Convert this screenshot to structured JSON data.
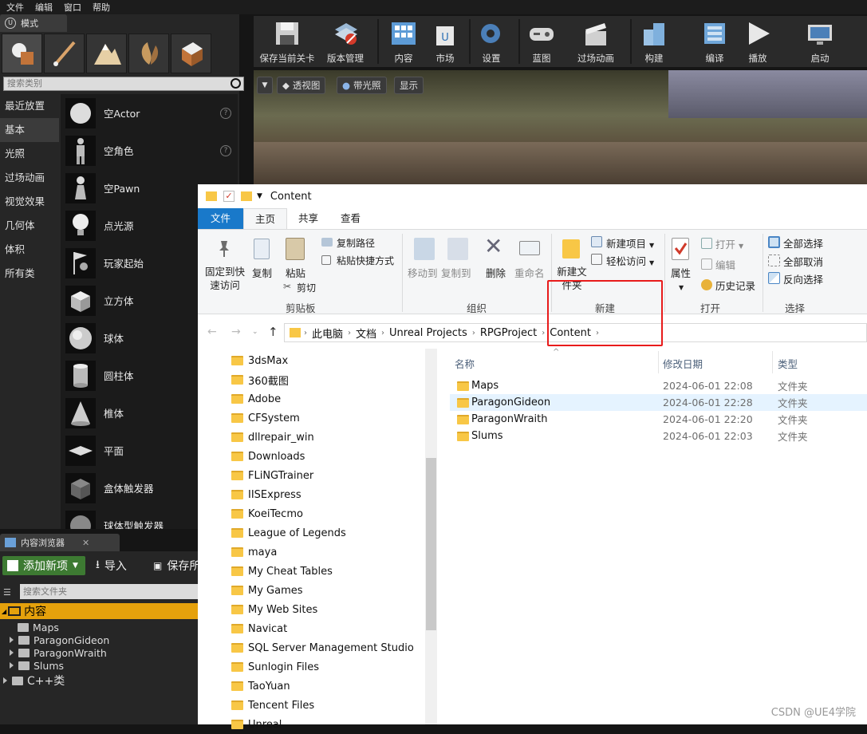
{
  "ue_menu": [
    "文件",
    "编辑",
    "窗口",
    "帮助"
  ],
  "modes": {
    "tab_label": "模式",
    "search_placeholder": "搜索类别",
    "categories": [
      "最近放置",
      "基本",
      "光照",
      "过场动画",
      "视觉效果",
      "几何体",
      "体积",
      "所有类"
    ],
    "selected_category": "基本",
    "assets": [
      "空Actor",
      "空角色",
      "空Pawn",
      "点光源",
      "玩家起始",
      "立方体",
      "球体",
      "圆柱体",
      "椎体",
      "平面",
      "盒体触发器",
      "球体型触发器"
    ]
  },
  "toolbar": [
    "保存当前关卡",
    "版本管理",
    "内容",
    "市场",
    "设置",
    "蓝图",
    "过场动画",
    "构建",
    "编译",
    "播放",
    "启动"
  ],
  "viewport": {
    "buttons": [
      "透视图",
      "带光照",
      "显示"
    ]
  },
  "content_browser": {
    "tab_label": "内容浏览器",
    "add_new": "添加新项",
    "import": "导入",
    "save": "保存所",
    "folder_search_placeholder": "搜索文件夹",
    "root": "内容",
    "folders": [
      "Maps",
      "ParagonGideon",
      "ParagonWraith",
      "Slums"
    ],
    "cpp": "C++类"
  },
  "explorer": {
    "title": "Content",
    "tabs": [
      "文件",
      "主页",
      "共享",
      "查看"
    ],
    "ribbon": {
      "pin": "固定到快速访问",
      "copy": "复制",
      "paste": "粘贴",
      "copy_path": "复制路径",
      "paste_shortcut": "粘贴快捷方式",
      "cut": "剪切",
      "group_clipboard": "剪贴板",
      "move_to": "移动到",
      "copy_to": "复制到",
      "delete": "删除",
      "rename": "重命名",
      "group_organize": "组织",
      "new_folder": "新建文件夹",
      "new_item": "新建项目",
      "easy_access": "轻松访问",
      "group_new": "新建",
      "properties": "属性",
      "open": "打开",
      "edit": "编辑",
      "history": "历史记录",
      "group_open": "打开",
      "select_all": "全部选择",
      "select_none": "全部取消",
      "invert": "反向选择",
      "group_select": "选择"
    },
    "breadcrumb": [
      "此电脑",
      "文档",
      "Unreal Projects",
      "RPGProject",
      "Content"
    ],
    "nav_items": [
      "3dsMax",
      "360截图",
      "Adobe",
      "CFSystem",
      "dllrepair_win",
      "Downloads",
      "FLiNGTrainer",
      "IISExpress",
      "KoeiTecmo",
      "League of Legends",
      "maya",
      "My Cheat Tables",
      "My Games",
      "My Web Sites",
      "Navicat",
      "SQL Server Management Studio",
      "Sunlogin Files",
      "TaoYuan",
      "Tencent Files",
      "Unreal"
    ],
    "columns": {
      "name": "名称",
      "date": "修改日期",
      "type": "类型"
    },
    "files": [
      {
        "name": "Maps",
        "date": "2024-06-01 22:08",
        "type": "文件夹"
      },
      {
        "name": "ParagonGideon",
        "date": "2024-06-01 22:28",
        "type": "文件夹"
      },
      {
        "name": "ParagonWraith",
        "date": "2024-06-01 22:20",
        "type": "文件夹"
      },
      {
        "name": "Slums",
        "date": "2024-06-01 22:03",
        "type": "文件夹"
      }
    ]
  },
  "watermark": "CSDN @UE4学院"
}
